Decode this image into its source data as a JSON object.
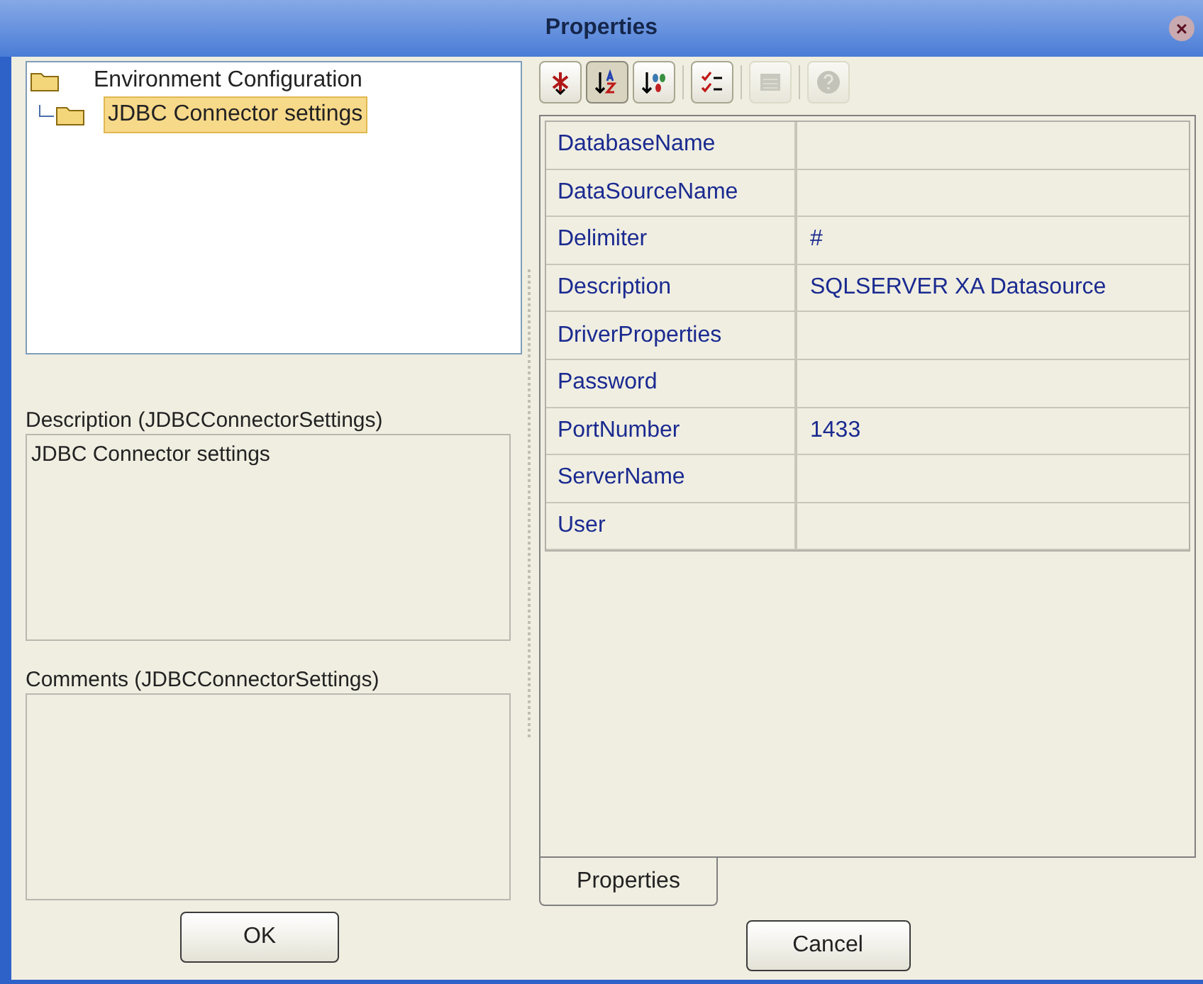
{
  "window": {
    "title": "Properties",
    "close": "×"
  },
  "tree": [
    {
      "label": "Environment Configuration",
      "selected": false,
      "children": [
        {
          "label": "JDBC Connector settings",
          "selected": true
        }
      ]
    }
  ],
  "description": {
    "label": "Description (JDBCConnectorSettings)",
    "value": "JDBC Connector settings"
  },
  "comments": {
    "label": "Comments (JDBCConnectorSettings)"
  },
  "toolbar": [
    {
      "kind": "expand",
      "selected": false,
      "disabled": false
    },
    {
      "kind": "sort-az",
      "selected": true,
      "disabled": false
    },
    {
      "kind": "sort-category",
      "selected": false,
      "disabled": false
    },
    {
      "kind": "checklist",
      "selected": false,
      "disabled": false
    },
    {
      "kind": "grid",
      "selected": false,
      "disabled": true
    },
    {
      "kind": "help",
      "selected": false,
      "disabled": true
    }
  ],
  "properties": [
    {
      "name": "DatabaseName"
    },
    {
      "name": "DataSourceName"
    },
    {
      "name": "Delimiter",
      "value": "#"
    },
    {
      "name": "Description",
      "value": "SQLSERVER XA Datasource"
    },
    {
      "name": "DriverProperties"
    },
    {
      "name": "Password"
    },
    {
      "name": "PortNumber",
      "value": "1433"
    },
    {
      "name": "ServerName"
    },
    {
      "name": "User"
    }
  ],
  "tabs": [
    {
      "label": "Properties",
      "selected": true
    }
  ],
  "buttons": [
    "OK",
    "Cancel"
  ]
}
